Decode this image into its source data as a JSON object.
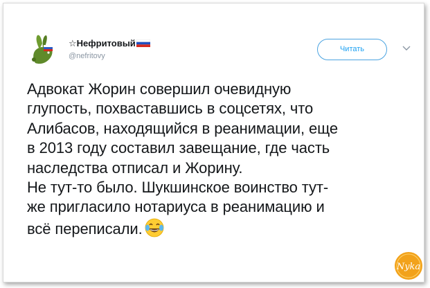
{
  "author": {
    "name": "☆Нефритовый",
    "handle": "@nefritovy",
    "flag_icon": "russian-flag-icon",
    "avatar_icon": "green-rabbit-avatar-icon"
  },
  "actions": {
    "follow_label": "Читать",
    "menu_icon": "chevron-down-icon"
  },
  "tweet": {
    "lines": [
      "Адвокат Жорин совершил очевидную",
      "глупость, похвастав­шись в соцсетях, что",
      "Алибасов, находящийся в реанимации, еще",
      "в 2013 году составил завещание, где часть",
      "наследства отписал и Жорину.",
      "Не тут-то было. Шукшинское воинство тут-",
      "же пригласило нотариуса в реанимацию и",
      "всё переписали."
    ],
    "emoji": "face-with-tears-of-joy-icon"
  },
  "watermark": {
    "text": "Nyka",
    "icon": "nyka-logo-icon"
  },
  "colors": {
    "accent": "#1da1f2",
    "text": "#14171a",
    "muted": "#8a96a3",
    "avatar_green": "#5f8a2a"
  }
}
